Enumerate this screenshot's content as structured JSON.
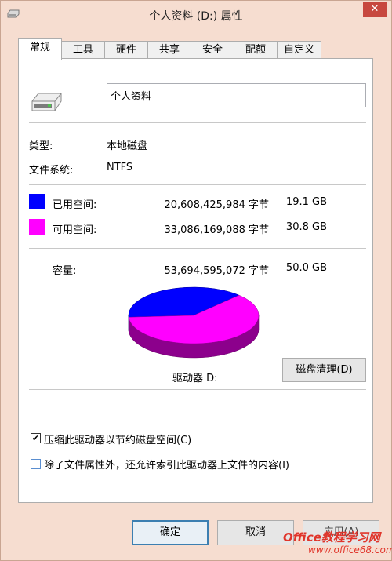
{
  "window": {
    "title": "个人资料 (D:) 属性",
    "close_glyph": "✕"
  },
  "tabs": [
    {
      "label": "常规",
      "active": true
    },
    {
      "label": "工具"
    },
    {
      "label": "硬件"
    },
    {
      "label": "共享"
    },
    {
      "label": "安全"
    },
    {
      "label": "配额"
    },
    {
      "label": "自定义"
    }
  ],
  "general": {
    "drive_icon": "hard-drive-icon",
    "name_value": "个人资料",
    "type_label": "类型:",
    "type_value": "本地磁盘",
    "fs_label": "文件系统:",
    "fs_value": "NTFS",
    "used": {
      "label": "已用空间:",
      "bytes": "20,608,425,984 字节",
      "size": "19.1 GB",
      "color": "#0000ff"
    },
    "free": {
      "label": "可用空间:",
      "bytes": "33,086,169,088 字节",
      "size": "30.8 GB",
      "color": "#ff00ff"
    },
    "capacity": {
      "label": "容量:",
      "bytes": "53,694,595,072 字节",
      "size": "50.0 GB"
    },
    "drive_label": "驱动器 D:",
    "cleanup_button": "磁盘清理(D)",
    "compress_checkbox": {
      "label": "压缩此驱动器以节约磁盘空间(C)",
      "checked": true,
      "mark": "✔"
    },
    "index_checkbox": {
      "label": "除了文件属性外，还允许索引此驱动器上文件的内容(I)",
      "checked": false
    }
  },
  "buttons": {
    "ok": "确定",
    "cancel": "取消",
    "apply": "应用(A)"
  },
  "chart_data": {
    "type": "pie",
    "title": "",
    "slices": [
      {
        "label": "已用空间",
        "value": 19.1,
        "color": "#0000ff"
      },
      {
        "label": "可用空间",
        "value": 30.8,
        "color": "#ff00ff"
      }
    ]
  },
  "watermark": {
    "text": "Office教程学习网",
    "url": "www.office68.com"
  }
}
